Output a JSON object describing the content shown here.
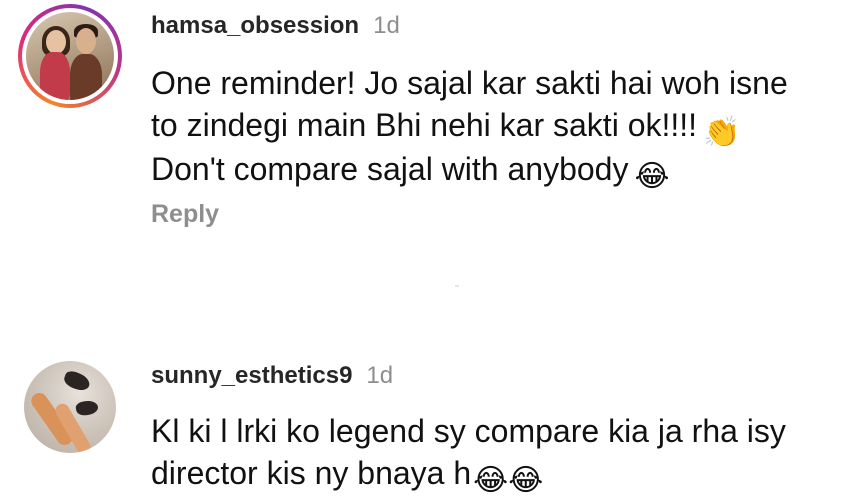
{
  "comments": [
    {
      "username": "hamsa_obsession",
      "time": "1d",
      "lines": [
        "One reminder! Jo sajal kar sakti hai woh isne",
        "to zindegi main Bhi nehi kar sakti ok!!!!",
        "Don't compare sajal with anybody"
      ],
      "line2_emoji": "👏",
      "line3_emoji": "😂",
      "reply_label": "Reply"
    },
    {
      "username": "sunny_esthetics9",
      "time": "1d",
      "lines": [
        "Kl ki l lrki ko legend sy compare kia ja rha isy",
        "director kis ny bnaya h"
      ],
      "line2_emoji": "😂😂"
    }
  ],
  "icons": {
    "clap": "clapping-hands-emoji",
    "laugh": "tears-of-joy-emoji"
  }
}
